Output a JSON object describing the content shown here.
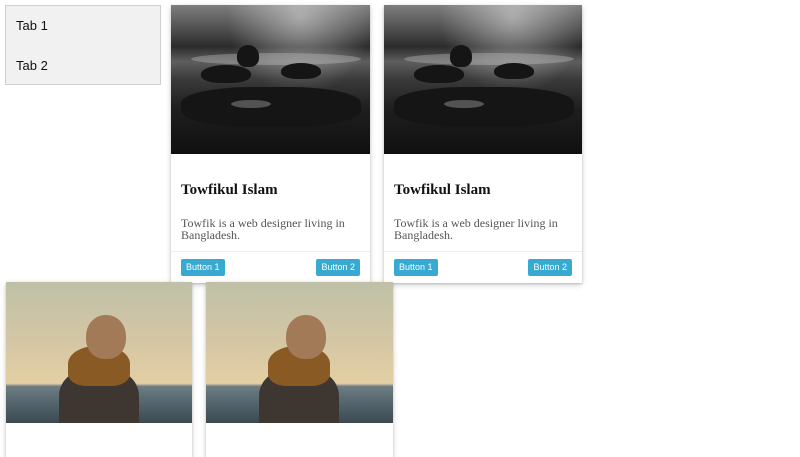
{
  "tabs": [
    "Tab 1",
    "Tab 2"
  ],
  "cards": [
    {
      "image": "rocky-coast-image",
      "title": "Towfikul Islam",
      "text": "Towfik is a web designer living in Bangladesh.",
      "button1": "Button 1",
      "button2": "Button 2"
    },
    {
      "image": "rocky-coast-image",
      "title": "Towfikul Islam",
      "text": "Towfik is a web designer living in Bangladesh.",
      "button1": "Button 1",
      "button2": "Button 2"
    },
    {
      "image": "person-at-sea-image"
    },
    {
      "image": "person-at-sea-image"
    }
  ],
  "colors": {
    "button": "#38a9d1",
    "tabs_bg": "#f1f1f1"
  }
}
